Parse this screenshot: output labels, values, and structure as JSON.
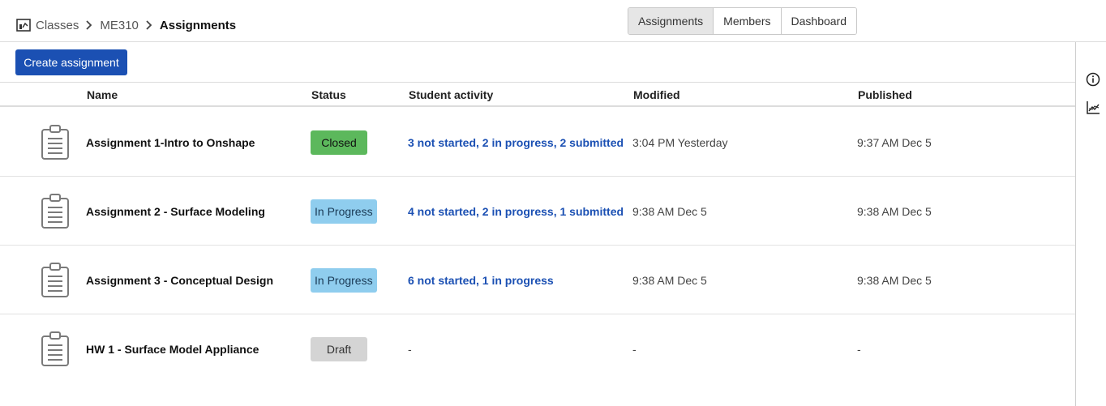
{
  "breadcrumb": {
    "root": "Classes",
    "class": "ME310",
    "current": "Assignments"
  },
  "tabs": [
    "Assignments",
    "Members",
    "Dashboard"
  ],
  "actions": {
    "create_label": "Create assignment"
  },
  "columns": {
    "name": "Name",
    "status": "Status",
    "activity": "Student activity",
    "modified": "Modified",
    "published": "Published"
  },
  "rows": [
    {
      "name": "Assignment 1-Intro to Onshape",
      "status": "Closed",
      "activity": "3 not started, 2 in progress, 2 submitted",
      "modified": "3:04 PM Yesterday",
      "published": "9:37 AM Dec 5"
    },
    {
      "name": "Assignment 2 - Surface Modeling",
      "status": "In Progress",
      "activity": "4 not started, 2 in progress, 1 submitted",
      "modified": "9:38 AM Dec 5",
      "published": "9:38 AM Dec 5"
    },
    {
      "name": "Assignment 3 - Conceptual Design",
      "status": "In Progress",
      "activity": "6 not started, 1 in progress",
      "modified": "9:38 AM Dec 5",
      "published": "9:38 AM Dec 5"
    },
    {
      "name": "HW 1 - Surface Model Appliance",
      "status": "Draft",
      "activity": "-",
      "modified": "-",
      "published": "-"
    }
  ],
  "colors": {
    "primary": "#1b50b3",
    "closed": "#5cb85c",
    "in_progress": "#8fcdee",
    "draft": "#d4d4d4"
  },
  "icons": {
    "breadcrumb": "class-board-icon",
    "row": "clipboard-icon",
    "rail": [
      "info-icon",
      "chart-icon"
    ]
  }
}
